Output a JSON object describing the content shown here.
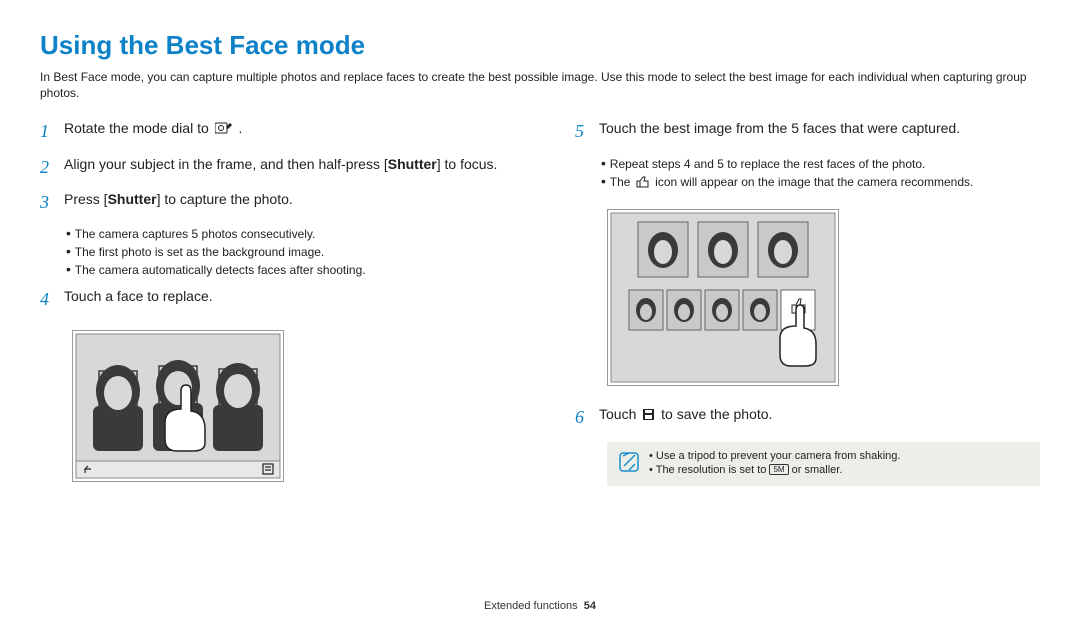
{
  "title": "Using the Best Face mode",
  "intro": "In Best Face mode, you can capture multiple photos and replace faces to create the best possible image. Use this mode to select the best image for each individual when capturing group photos.",
  "left_steps": {
    "s1": {
      "num": "1",
      "text_a": "Rotate the mode dial to ",
      "text_b": "."
    },
    "s2": {
      "num": "2",
      "text_a": "Align your subject in the frame, and then half-press [",
      "shutter": "Shutter",
      "text_b": "] to focus."
    },
    "s3": {
      "num": "3",
      "text_a": "Press [",
      "shutter": "Shutter",
      "text_b": "] to capture the photo.",
      "bullets": [
        "The camera captures 5 photos consecutively.",
        "The first photo is set as the background image.",
        "The camera automatically detects faces after shooting."
      ]
    },
    "s4": {
      "num": "4",
      "text": "Touch a face to replace."
    }
  },
  "right_steps": {
    "s5": {
      "num": "5",
      "text": "Touch the best image from the 5 faces that were captured.",
      "bullets_a": "Repeat steps 4 and 5 to replace the rest faces of the photo.",
      "bullets_b1": "The ",
      "bullets_b2": " icon will appear on the image that the camera recommends."
    },
    "s6": {
      "num": "6",
      "text_a": "Touch ",
      "text_b": " to save the photo."
    }
  },
  "notes": {
    "n1": "Use a tripod to prevent your camera from shaking.",
    "n2_a": "The resolution is set to ",
    "n2_badge": "5M",
    "n2_b": " or smaller."
  },
  "footer": {
    "section": "Extended functions",
    "page": "54"
  }
}
